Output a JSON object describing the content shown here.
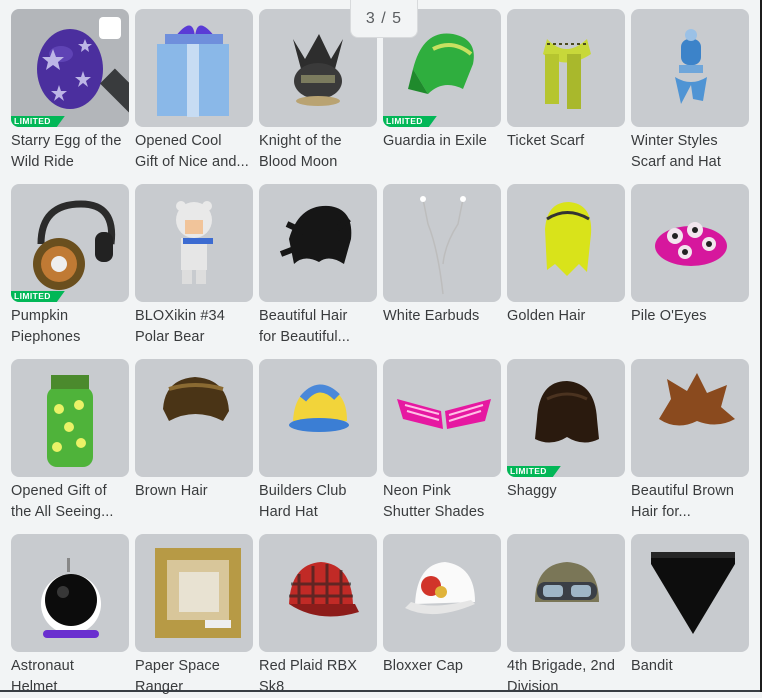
{
  "pager": {
    "text": "3 / 5"
  },
  "badges": {
    "limited": "LIMITED"
  },
  "items": [
    {
      "name": "Starry Egg of the\nWild Ride",
      "limited": true,
      "selected": true,
      "icon": "starry-egg-icon"
    },
    {
      "name": "Opened Cool\nGift of Nice and...",
      "limited": false,
      "icon": "gift-box-icon"
    },
    {
      "name": "Knight of the\nBlood Moon",
      "limited": false,
      "icon": "knight-helmet-icon"
    },
    {
      "name": "Guardia in Exile",
      "limited": true,
      "icon": "green-helmet-icon"
    },
    {
      "name": "Ticket Scarf",
      "limited": false,
      "icon": "ticket-scarf-icon"
    },
    {
      "name": "Winter Styles\nScarf and Hat",
      "limited": false,
      "icon": "winter-hat-icon"
    },
    {
      "name": "Pumpkin\nPiephones",
      "limited": true,
      "icon": "headphones-icon"
    },
    {
      "name": "BLOXikin #34\nPolar Bear",
      "limited": false,
      "icon": "polar-bear-figure-icon"
    },
    {
      "name": "Beautiful Hair\nfor Beautiful...",
      "limited": false,
      "icon": "black-hair-icon"
    },
    {
      "name": "White Earbuds",
      "limited": false,
      "icon": "earbuds-icon"
    },
    {
      "name": "Golden Hair",
      "limited": false,
      "icon": "golden-hair-icon"
    },
    {
      "name": "Pile O'Eyes",
      "limited": false,
      "icon": "eyes-pile-icon"
    },
    {
      "name": "Opened Gift of\nthe All Seeing...",
      "limited": false,
      "icon": "eye-gift-icon"
    },
    {
      "name": "Brown Hair",
      "limited": false,
      "icon": "brown-hair-icon"
    },
    {
      "name": "Builders Club\nHard Hat",
      "limited": false,
      "icon": "hard-hat-icon"
    },
    {
      "name": "Neon Pink\nShutter Shades",
      "limited": false,
      "icon": "shutter-shades-icon"
    },
    {
      "name": "Shaggy",
      "limited": true,
      "icon": "shaggy-hair-icon"
    },
    {
      "name": "Beautiful Brown\nHair for...",
      "limited": false,
      "icon": "spiky-brown-hair-icon"
    },
    {
      "name": "Astronaut\nHelmet",
      "limited": false,
      "icon": "astronaut-helmet-icon"
    },
    {
      "name": "Paper Space\nRanger",
      "limited": false,
      "icon": "paper-box-icon"
    },
    {
      "name": "Red Plaid RBX\nSk8",
      "limited": false,
      "icon": "plaid-cap-icon"
    },
    {
      "name": "Bloxxer Cap",
      "limited": false,
      "icon": "white-cap-icon"
    },
    {
      "name": "4th Brigade, 2nd\nDivision",
      "limited": false,
      "icon": "army-helmet-icon"
    },
    {
      "name": "Bandit",
      "limited": false,
      "icon": "bandana-icon"
    }
  ]
}
